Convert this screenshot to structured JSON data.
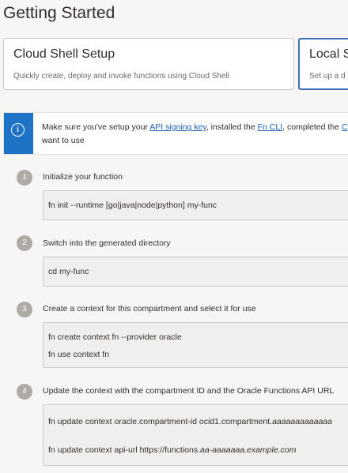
{
  "page": {
    "title": "Getting Started"
  },
  "cards": [
    {
      "title": "Cloud Shell Setup",
      "desc": "Quickly create, deploy and invoke functions using Cloud Shell"
    },
    {
      "title": "Local S",
      "desc": "Set up a d"
    }
  ],
  "info": {
    "line1_prefix": "Make sure you've setup your ",
    "link1": "API signing key",
    "line1_mid": ", installed the ",
    "link2": "Fn CLI",
    "line1_suffix": ", completed the ",
    "link3": "C",
    "line2": "want to use"
  },
  "steps": [
    {
      "num": "1",
      "title": "Initialize your function",
      "lines": [
        "fn init --runtime [go|java|node|python] my-func"
      ]
    },
    {
      "num": "2",
      "title": "Switch into the generated directory",
      "lines": [
        "cd my-func"
      ]
    },
    {
      "num": "3",
      "title": "Create a context for this compartment and select it for use",
      "lines": [
        "fn create context fn --provider oracle",
        "fn use context fn"
      ]
    },
    {
      "num": "4",
      "title": "Update the context with the compartment ID and the Oracle Functions API URL",
      "line1_prefix": "fn update context oracle.compartment-id ocid1.compartment.",
      "line1_italic": "aaaaaaaaaaaaa",
      "line2_prefix": "fn update context api-url https://functions.",
      "line2_italic": "aa-aaaaaaa.example.com"
    }
  ],
  "colors": {
    "accent": "#1f73c6",
    "selected_border": "#3a70b7",
    "step_badge": "#aeaba7",
    "code_bg": "#f1efed"
  },
  "icons": {
    "info": "info-icon"
  }
}
